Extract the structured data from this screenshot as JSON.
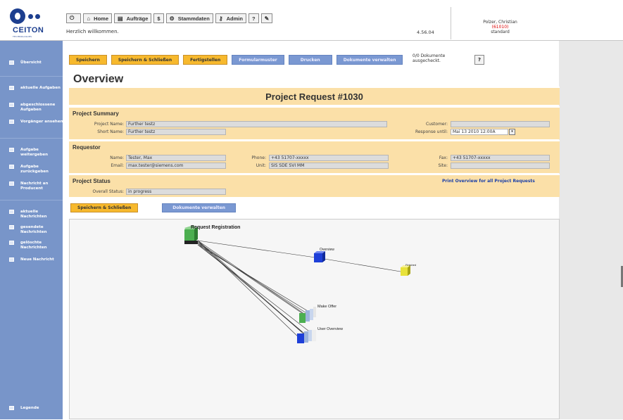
{
  "header": {
    "logo_text": "CEITON",
    "logo_subtext": "TECHNOLOGIES",
    "nav": [
      {
        "icon": "power-icon",
        "label": ""
      },
      {
        "icon": "home-icon",
        "label": "Home"
      },
      {
        "icon": "list-icon",
        "label": "Aufträge"
      },
      {
        "icon": "dollar-icon",
        "label": "$"
      },
      {
        "icon": "settings-icon",
        "label": "Stammdaten"
      },
      {
        "icon": "key-icon",
        "label": "Admin"
      },
      {
        "icon": "help-icon",
        "label": "?"
      },
      {
        "icon": "edit-icon",
        "label": ""
      }
    ],
    "welcome": "Herzlich willkommen.",
    "version": "4.56.04",
    "user_name": "Polzer, Christian",
    "user_id": "(61010)",
    "user_role": "standard"
  },
  "sidebar": {
    "items": [
      {
        "label": "Übersicht"
      },
      {
        "label": "aktuelle Aufgaben"
      },
      {
        "label": "abgeschlossene Aufgaben"
      },
      {
        "label": "Vorgänger ansehen"
      },
      {
        "label": "Aufgabe weitergeben"
      },
      {
        "label": "Aufgabe zurückgeben"
      },
      {
        "label": "Nachricht an Producent"
      },
      {
        "label": "aktuelle Nachrichten"
      },
      {
        "label": "gesendete Nachrichten"
      },
      {
        "label": "gelöschte Nachrichten"
      },
      {
        "label": "Neue Nachricht"
      }
    ],
    "legend": "Legende"
  },
  "toolbar": {
    "save": "Speichern",
    "save_close": "Speichern & Schließen",
    "finish": "Fertigstellen",
    "form_template": "Formularmuster",
    "print": "Drucken",
    "manage_docs": "Dokumente verwalten",
    "doc_status_line1": "0/0 Dokumente",
    "doc_status_line2": "ausgecheckt.",
    "help": "?"
  },
  "page_title": "Overview",
  "request_title": "Project Request #1030",
  "summary": {
    "title": "Project Summary",
    "project_name_label": "Project Name:",
    "project_name": "Further testz",
    "short_name_label": "Short Name:",
    "short_name": "Further testz",
    "customer_label": "Customer:",
    "customer": "",
    "response_label": "Response until:",
    "response": "Mai 13 2010 12:00A"
  },
  "requestor": {
    "title": "Requestor",
    "name_label": "Name:",
    "name": "Tester, Max",
    "email_label": "Email:",
    "email": "max.tester@siemens.com",
    "phone_label": "Phone:",
    "phone": "+43 51707-xxxxx",
    "unit_label": "Unit:",
    "unit": "SIS SDE SVI MM",
    "fax_label": "Fax:",
    "fax": "+43 51707-xxxxx",
    "site_label": "Site:",
    "site": ""
  },
  "status": {
    "title": "Project Status",
    "overall_label": "Overall Status:",
    "overall": "in progress",
    "print_link": "Print Overview for all Project Requests"
  },
  "bottom_buttons": {
    "save_close": "Speichern & Schließen",
    "manage_docs": "Dokumente verwalten"
  },
  "diagram": {
    "nodes": [
      {
        "label": "Request Registration",
        "color": "#4caf50"
      },
      {
        "label": "Overview",
        "color": "#1e3fd8"
      },
      {
        "label": "Finished",
        "color": "#e8e23a"
      },
      {
        "label": "Make Offer",
        "color": "#4caf50"
      },
      {
        "label": "User Overview",
        "color": "#1e3fd8"
      }
    ]
  },
  "colors": {
    "sidebar": "#7895c9",
    "panel": "#fbe0a8",
    "button_orange": "#f7b92d",
    "button_blue": "#7a98d2"
  }
}
